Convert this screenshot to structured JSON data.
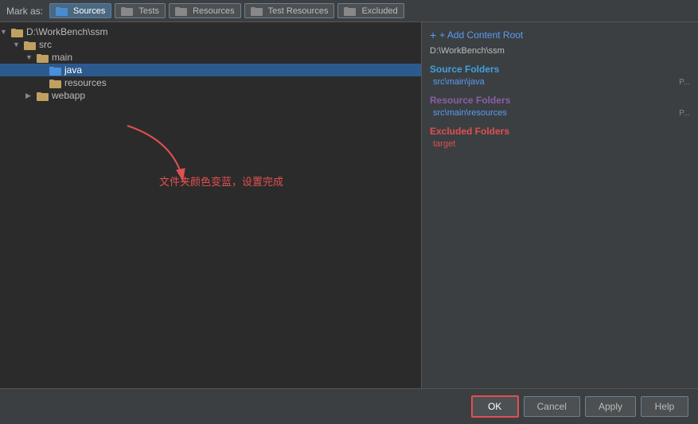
{
  "markAs": {
    "label": "Mark as:",
    "buttons": [
      {
        "id": "sources",
        "label": "Sources",
        "active": true,
        "color": "#4a90d9"
      },
      {
        "id": "tests",
        "label": "Tests",
        "active": false,
        "color": "#4a90d9"
      },
      {
        "id": "resources",
        "label": "Resources",
        "active": false,
        "color": "#4a90d9"
      },
      {
        "id": "testResources",
        "label": "Test Resources",
        "active": false,
        "color": "#4a90d9"
      },
      {
        "id": "excluded",
        "label": "Excluded",
        "active": false,
        "color": "#4a90d9"
      }
    ]
  },
  "tree": {
    "rootPath": "D:\\WorkBench\\ssm",
    "items": [
      {
        "label": "D:\\WorkBench\\ssm",
        "level": 0,
        "hasArrow": true,
        "expanded": true,
        "type": "folder-plain"
      },
      {
        "label": "src",
        "level": 1,
        "hasArrow": true,
        "expanded": true,
        "type": "folder-plain"
      },
      {
        "label": "main",
        "level": 2,
        "hasArrow": true,
        "expanded": true,
        "type": "folder-plain"
      },
      {
        "label": "java",
        "level": 3,
        "hasArrow": false,
        "expanded": false,
        "type": "folder-blue",
        "selected": true
      },
      {
        "label": "resources",
        "level": 3,
        "hasArrow": false,
        "expanded": false,
        "type": "folder-plain"
      },
      {
        "label": "webapp",
        "level": 2,
        "hasArrow": true,
        "expanded": false,
        "type": "folder-plain"
      }
    ]
  },
  "annotation": {
    "text": "文件夹颜色变蓝，设置完成"
  },
  "rightPanel": {
    "addContentRoot": "+ Add Content Root",
    "rootPath": "D:\\WorkBench\\ssm",
    "sections": [
      {
        "title": "Source Folders",
        "type": "sources",
        "paths": [
          {
            "path": "src\\main\\java",
            "suffix": "P..."
          }
        ]
      },
      {
        "title": "Resource Folders",
        "type": "resources",
        "paths": [
          {
            "path": "src\\main\\resources",
            "suffix": "P..."
          }
        ]
      },
      {
        "title": "Excluded Folders",
        "type": "excluded",
        "paths": [
          {
            "path": "target",
            "suffix": ""
          }
        ]
      }
    ]
  },
  "buttons": {
    "ok": "OK",
    "cancel": "Cancel",
    "apply": "Apply",
    "help": "Help"
  }
}
